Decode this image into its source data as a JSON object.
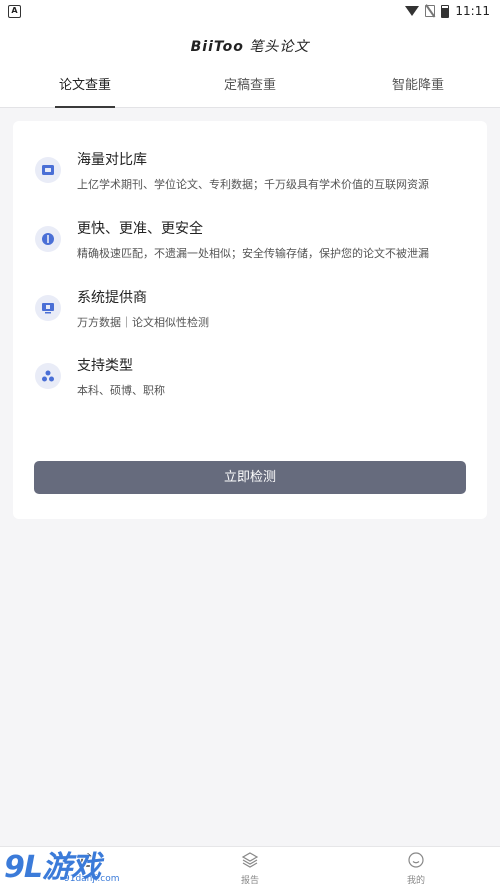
{
  "status_bar": {
    "left_icon": "a-notification-icon",
    "time": "11:11",
    "icons": [
      "wifi-icon",
      "no-sim-icon",
      "battery-icon"
    ]
  },
  "header": {
    "brand": "BiiToo",
    "title": "笔头论文"
  },
  "tabs": [
    {
      "label": "论文查重",
      "active": true
    },
    {
      "label": "定稿查重",
      "active": false
    },
    {
      "label": "智能降重",
      "active": false
    }
  ],
  "features": [
    {
      "icon": "database-icon",
      "title": "海量对比库",
      "desc": "上亿学术期刊、学位论文、专利数据；千万级具有学术价值的互联网资源"
    },
    {
      "icon": "speed-icon",
      "title": "更快、更准、更安全",
      "desc": "精确极速匹配，不遗漏一处相似；安全传输存储，保护您的论文不被泄漏"
    },
    {
      "icon": "provider-icon",
      "title": "系统提供商",
      "desc": "万方数据｜论文相似性检测"
    },
    {
      "icon": "types-icon",
      "title": "支持类型",
      "desc": "本科、硕博、职称"
    }
  ],
  "actions": {
    "detect_label": "立即检测"
  },
  "bottom_nav": [
    {
      "icon": "home-icon",
      "label": ""
    },
    {
      "icon": "layers-icon",
      "label": "报告"
    },
    {
      "icon": "smile-icon",
      "label": "我的"
    }
  ],
  "watermark": {
    "main": "9L游戏",
    "url": "91danji.com"
  },
  "colors": {
    "accent_button": "#666b7d",
    "icon_bg": "#e9ecf7",
    "icon_fg": "#4a6fd6",
    "watermark": "#3b7bd9"
  }
}
